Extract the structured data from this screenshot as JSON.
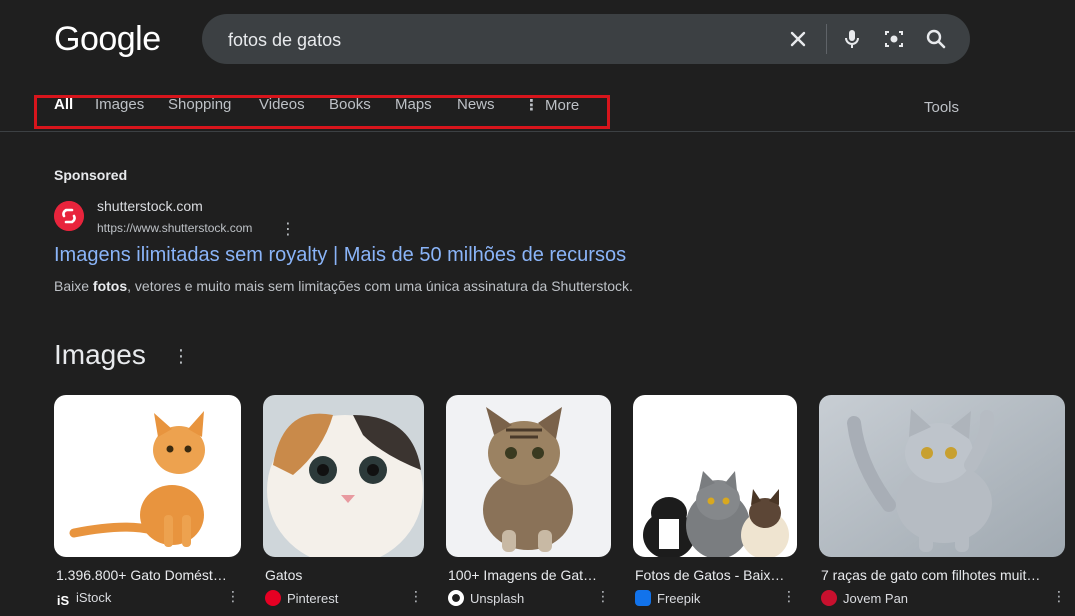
{
  "logo": "Google",
  "search": {
    "query": "fotos de gatos"
  },
  "tabs": [
    {
      "label": "All",
      "active": true
    },
    {
      "label": "Images"
    },
    {
      "label": "Shopping"
    },
    {
      "label": "Videos"
    },
    {
      "label": "Books"
    },
    {
      "label": "Maps"
    },
    {
      "label": "News"
    },
    {
      "label": "More"
    }
  ],
  "tools_label": "Tools",
  "ad": {
    "sponsored_label": "Sponsored",
    "site_name": "shutterstock.com",
    "url": "https://www.shutterstock.com",
    "title": "Imagens ilimitadas sem royalty | Mais de 50 milhões de recursos",
    "desc_before": "Baixe ",
    "desc_bold": "fotos",
    "desc_after": ", vetores e muito mais sem limitações com uma única assinatura da Shutterstock."
  },
  "images_section": {
    "heading": "Images",
    "cards": [
      {
        "title": "1.396.800+ Gato Domést…",
        "source": "iStock"
      },
      {
        "title": "Gatos",
        "source": "Pinterest"
      },
      {
        "title": "100+ Imagens de Gat…",
        "source": "Unsplash"
      },
      {
        "title": "Fotos de Gatos - Baix…",
        "source": "Freepik"
      },
      {
        "title": "7 raças de gato com filhotes muit…",
        "source": "Jovem Pan"
      }
    ]
  },
  "colors": {
    "background": "#1f1f1f",
    "link": "#8ab4f8",
    "highlight_box": "#d7151c"
  }
}
